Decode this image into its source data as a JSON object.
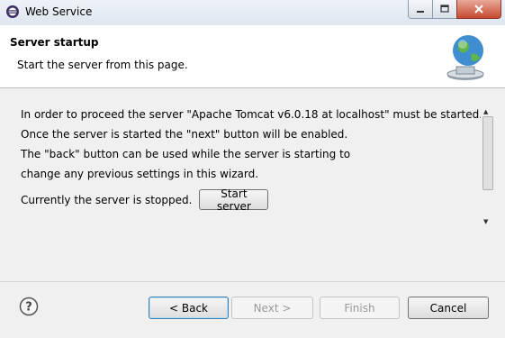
{
  "window": {
    "title": "Web Service",
    "icon": "eclipse-icon"
  },
  "banner": {
    "title": "Server startup",
    "description": "Start the server from this page.",
    "icon": "globe-server-icon"
  },
  "content": {
    "lines": [
      "In order to proceed the server \"Apache Tomcat v6.0.18 at localhost\" must be started.",
      "Once the server is started the \"next\" button will be enabled.",
      "The \"back\" button can be used while the server is starting to",
      "change any previous settings in this wizard."
    ],
    "status_text": "Currently the server is stopped.",
    "start_button": "Start server"
  },
  "footer": {
    "help_icon": "help-icon",
    "back": "< Back",
    "next": "Next >",
    "finish": "Finish",
    "cancel": "Cancel"
  }
}
